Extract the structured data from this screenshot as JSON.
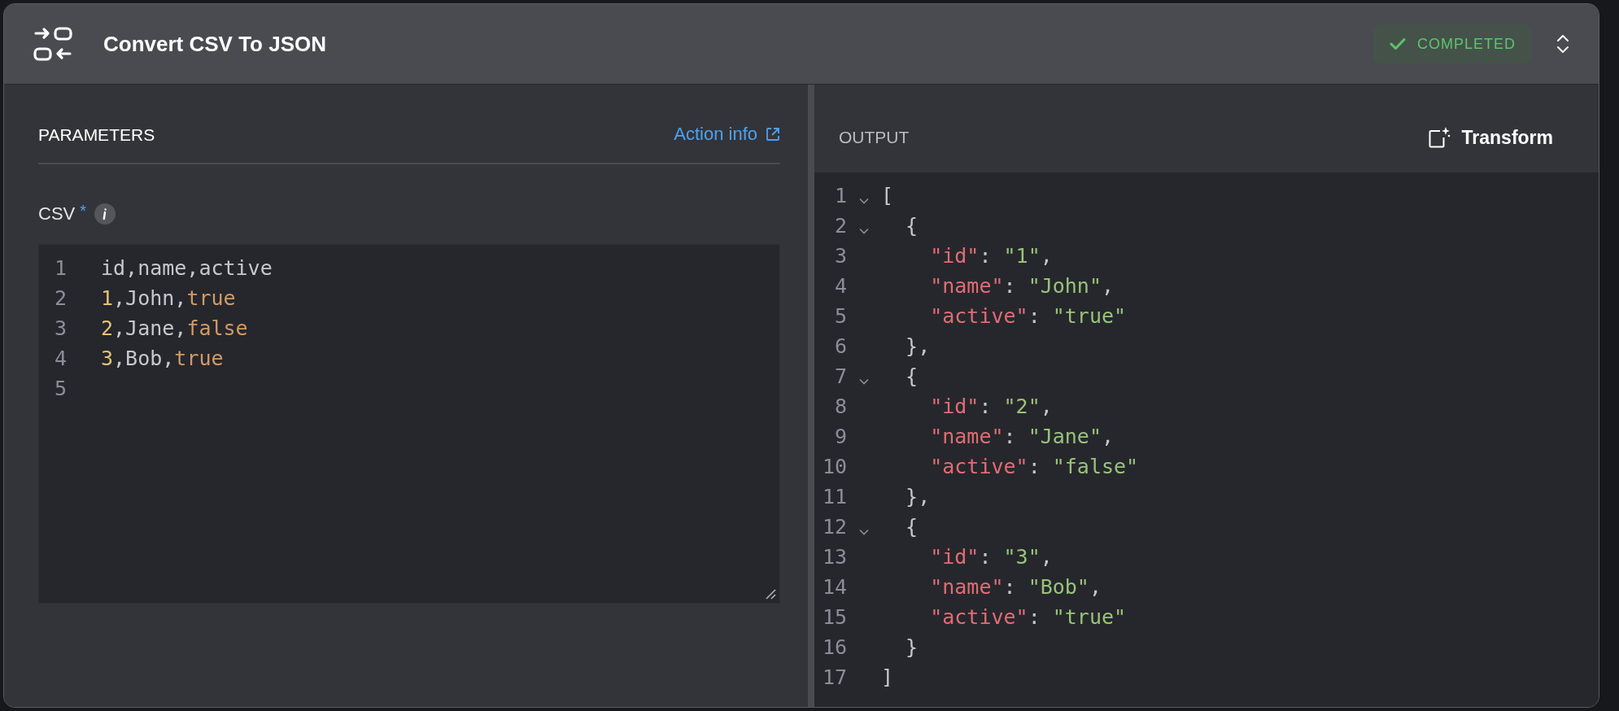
{
  "header": {
    "title": "Convert CSV To JSON",
    "status": {
      "label": "COMPLETED"
    }
  },
  "parameters": {
    "heading": "PARAMETERS",
    "link": "Action info",
    "field": {
      "label": "CSV",
      "required_mark": "*",
      "lines": [
        {
          "number": "1",
          "tokens": [
            {
              "kind": "plain",
              "text": "id,name,active"
            }
          ]
        },
        {
          "number": "2",
          "tokens": [
            {
              "kind": "number",
              "text": "1"
            },
            {
              "kind": "plain",
              "text": ",John,"
            },
            {
              "kind": "keyword",
              "text": "true"
            }
          ]
        },
        {
          "number": "3",
          "tokens": [
            {
              "kind": "number",
              "text": "2"
            },
            {
              "kind": "plain",
              "text": ",Jane,"
            },
            {
              "kind": "keyword",
              "text": "false"
            }
          ]
        },
        {
          "number": "4",
          "tokens": [
            {
              "kind": "number",
              "text": "3"
            },
            {
              "kind": "plain",
              "text": ",Bob,"
            },
            {
              "kind": "keyword",
              "text": "true"
            }
          ]
        },
        {
          "number": "5"
        }
      ]
    }
  },
  "output": {
    "heading": "OUTPUT",
    "button": "Transform",
    "lines": [
      {
        "number": "1",
        "foldable": true,
        "tokens": [
          {
            "kind": "plain",
            "text": "["
          }
        ]
      },
      {
        "number": "2",
        "foldable": true,
        "tokens": [
          {
            "kind": "plain",
            "text": "  {"
          }
        ]
      },
      {
        "number": "3",
        "foldable": false,
        "tokens": [
          {
            "kind": "key",
            "text": "    \"id\""
          },
          {
            "kind": "plain",
            "text": ": "
          },
          {
            "kind": "string",
            "text": "\"1\""
          },
          {
            "kind": "plain",
            "text": ","
          }
        ]
      },
      {
        "number": "4",
        "foldable": false,
        "tokens": [
          {
            "kind": "key",
            "text": "    \"name\""
          },
          {
            "kind": "plain",
            "text": ": "
          },
          {
            "kind": "string",
            "text": "\"John\""
          },
          {
            "kind": "plain",
            "text": ","
          }
        ]
      },
      {
        "number": "5",
        "foldable": false,
        "tokens": [
          {
            "kind": "key",
            "text": "    \"active\""
          },
          {
            "kind": "plain",
            "text": ": "
          },
          {
            "kind": "string",
            "text": "\"true\""
          }
        ]
      },
      {
        "number": "6",
        "foldable": false,
        "tokens": [
          {
            "kind": "plain",
            "text": "  },"
          }
        ]
      },
      {
        "number": "7",
        "foldable": true,
        "tokens": [
          {
            "kind": "plain",
            "text": "  {"
          }
        ]
      },
      {
        "number": "8",
        "foldable": false,
        "tokens": [
          {
            "kind": "key",
            "text": "    \"id\""
          },
          {
            "kind": "plain",
            "text": ": "
          },
          {
            "kind": "string",
            "text": "\"2\""
          },
          {
            "kind": "plain",
            "text": ","
          }
        ]
      },
      {
        "number": "9",
        "foldable": false,
        "tokens": [
          {
            "kind": "key",
            "text": "    \"name\""
          },
          {
            "kind": "plain",
            "text": ": "
          },
          {
            "kind": "string",
            "text": "\"Jane\""
          },
          {
            "kind": "plain",
            "text": ","
          }
        ]
      },
      {
        "number": "10",
        "foldable": false,
        "tokens": [
          {
            "kind": "key",
            "text": "    \"active\""
          },
          {
            "kind": "plain",
            "text": ": "
          },
          {
            "kind": "string",
            "text": "\"false\""
          }
        ]
      },
      {
        "number": "11",
        "foldable": false,
        "tokens": [
          {
            "kind": "plain",
            "text": "  },"
          }
        ]
      },
      {
        "number": "12",
        "foldable": true,
        "tokens": [
          {
            "kind": "plain",
            "text": "  {"
          }
        ]
      },
      {
        "number": "13",
        "foldable": false,
        "tokens": [
          {
            "kind": "key",
            "text": "    \"id\""
          },
          {
            "kind": "plain",
            "text": ": "
          },
          {
            "kind": "string",
            "text": "\"3\""
          },
          {
            "kind": "plain",
            "text": ","
          }
        ]
      },
      {
        "number": "14",
        "foldable": false,
        "tokens": [
          {
            "kind": "key",
            "text": "    \"name\""
          },
          {
            "kind": "plain",
            "text": ": "
          },
          {
            "kind": "string",
            "text": "\"Bob\""
          },
          {
            "kind": "plain",
            "text": ","
          }
        ]
      },
      {
        "number": "15",
        "foldable": false,
        "tokens": [
          {
            "kind": "key",
            "text": "    \"active\""
          },
          {
            "kind": "plain",
            "text": ": "
          },
          {
            "kind": "string",
            "text": "\"true\""
          }
        ]
      },
      {
        "number": "16",
        "foldable": false,
        "tokens": [
          {
            "kind": "plain",
            "text": "  }"
          }
        ]
      },
      {
        "number": "17",
        "foldable": false,
        "tokens": [
          {
            "kind": "plain",
            "text": "]"
          }
        ]
      }
    ]
  }
}
